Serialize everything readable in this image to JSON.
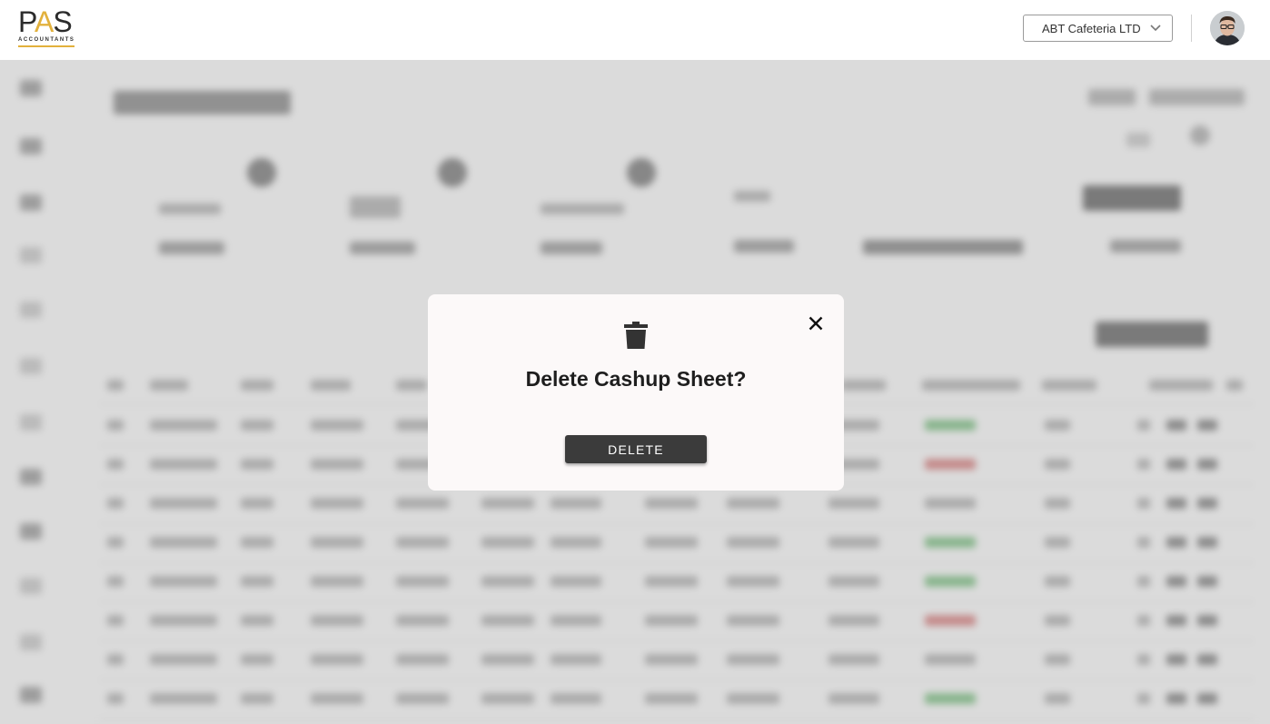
{
  "header": {
    "logo_text": "PAS",
    "logo_subtext": "ACCOUNTANTS",
    "company_selector": {
      "selected": "ABT Cafeteria LTD",
      "icon": "chevron-down-icon"
    },
    "avatar_alt": "User avatar"
  },
  "modal": {
    "icon": "trash-icon",
    "title": "Delete Cashup Sheet?",
    "delete_label": "DELETE",
    "close_icon": "close-icon"
  },
  "colors": {
    "accent": "#e2b13c",
    "button_dark": "#3b3b3b",
    "modal_bg": "#fcf9f9",
    "overlay": "rgba(0,0,0,0.14)"
  }
}
